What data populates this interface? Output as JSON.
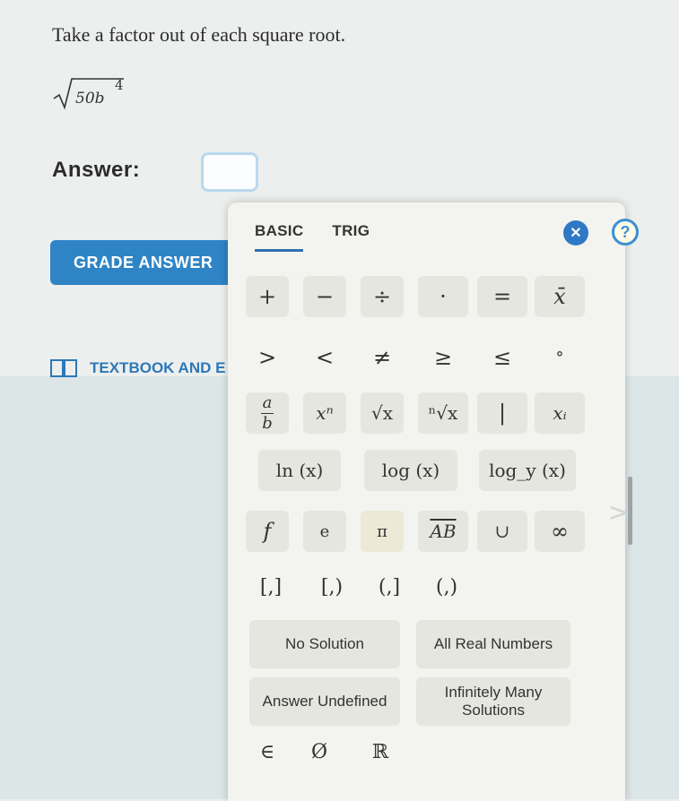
{
  "question": {
    "prompt": "Take a factor out of each square root.",
    "expression_radicand": "50b",
    "expression_exponent": "4"
  },
  "answer": {
    "label": "Answer:",
    "value": ""
  },
  "grade_button": {
    "label": "GRADE ANSWER"
  },
  "textbook_link": {
    "label": "TEXTBOOK AND E"
  },
  "keypad": {
    "tabs": [
      {
        "label": "BASIC"
      },
      {
        "label": "TRIG"
      }
    ],
    "close_label": "✕",
    "help_label": "?",
    "row1": [
      "+",
      "−",
      "÷",
      "·",
      "=",
      "x̄"
    ],
    "row2": [
      ">",
      "<",
      "≠",
      "≥",
      "≤",
      "°"
    ],
    "row3": {
      "frac_num": "a",
      "frac_den": "b",
      "power": "xⁿ",
      "sqrt": "√x",
      "nroot": "ⁿ√x",
      "abs": "|",
      "subscript": "xᵢ"
    },
    "row4": [
      "ln (x)",
      "log (x)",
      "log_y (x)"
    ],
    "row5": [
      "f",
      "e",
      "π",
      "AB",
      "∪",
      "∞"
    ],
    "row6": [
      "[,]",
      "[,)",
      "(,]",
      "(,)"
    ],
    "row7": [
      "No Solution",
      "All Real Numbers"
    ],
    "row8": [
      "Answer Undefined",
      "Infinitely Many Solutions"
    ],
    "row9": [
      "∈",
      "Ø",
      "ℝ"
    ]
  },
  "colors": {
    "primary": "#2f84c6",
    "link": "#2c78b8",
    "key_bg": "#e6e6e0"
  },
  "icons": [
    "book-icon",
    "close-icon",
    "help-icon",
    "chevron-right-icon"
  ]
}
